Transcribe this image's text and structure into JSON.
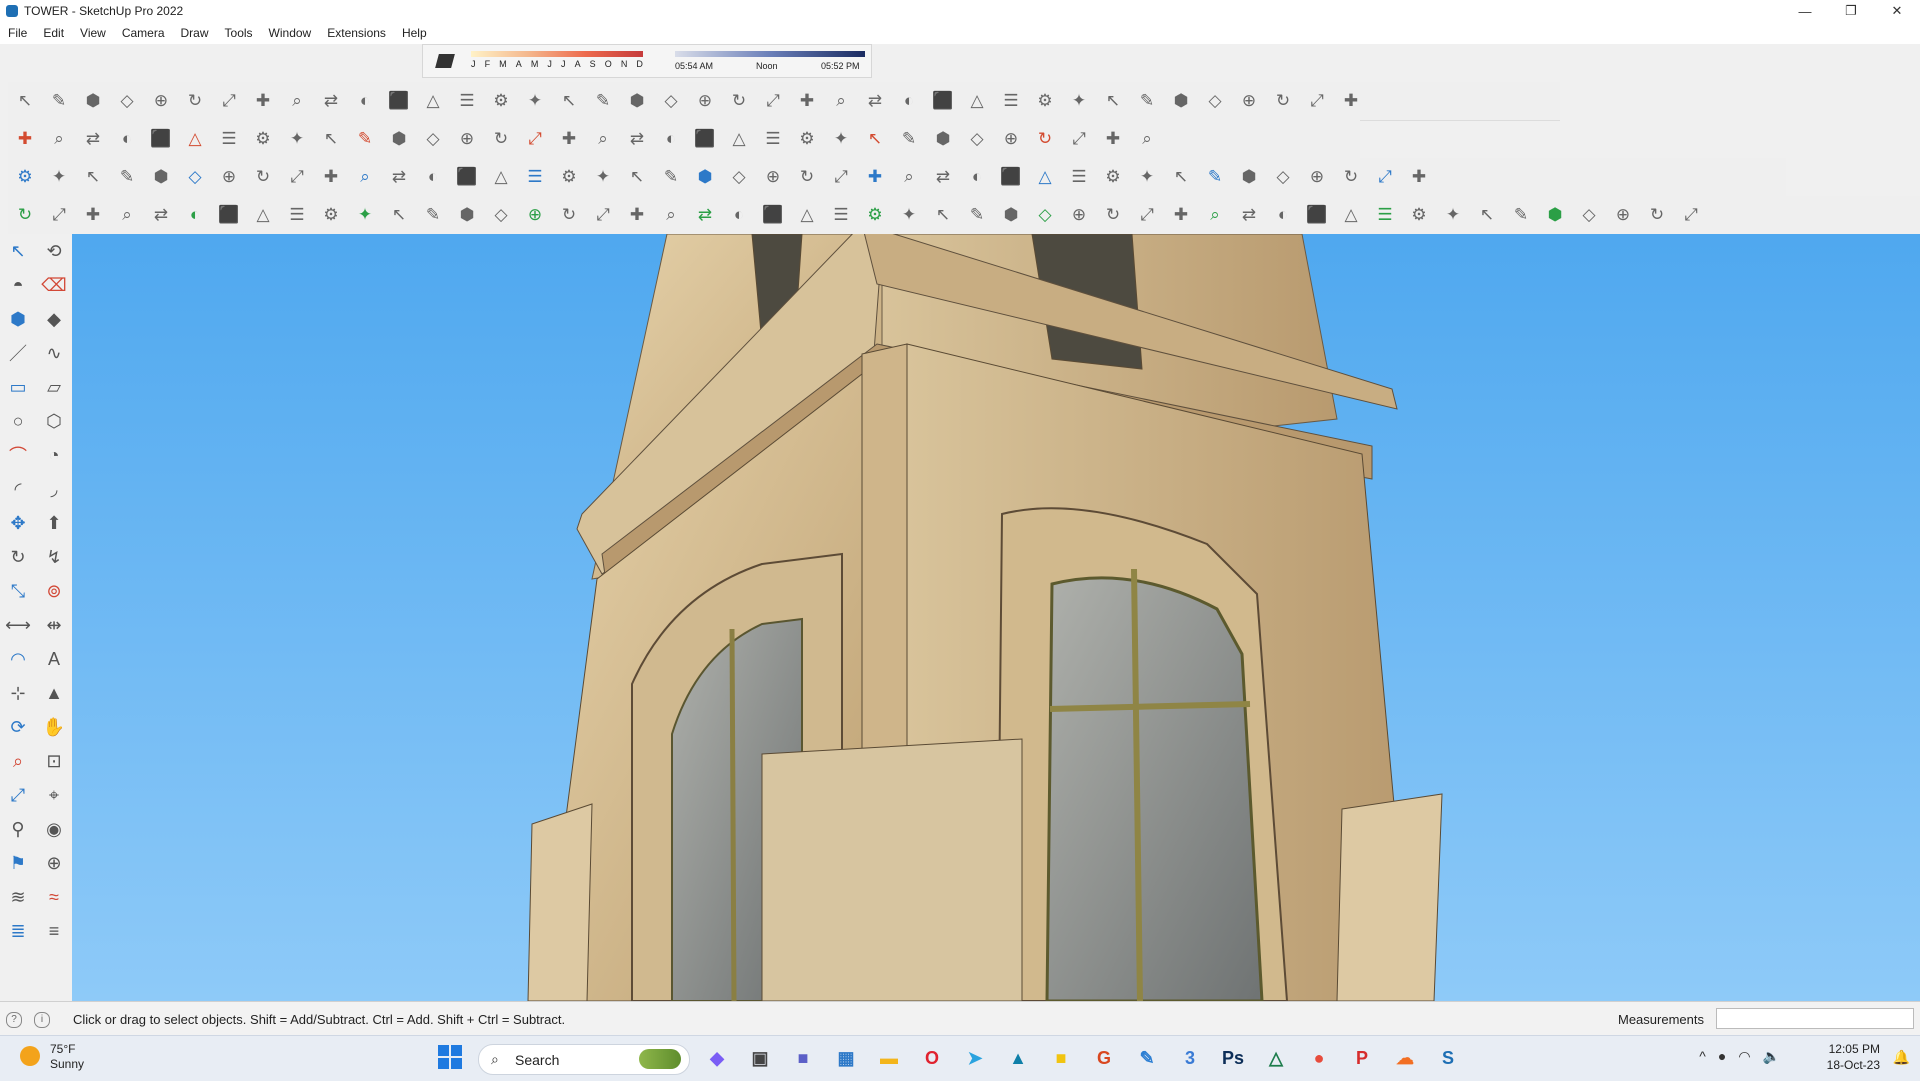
{
  "window": {
    "title": "TOWER - SketchUp Pro 2022",
    "controls": [
      "—",
      "❐",
      "✕"
    ]
  },
  "menubar": [
    "File",
    "Edit",
    "View",
    "Camera",
    "Draw",
    "Tools",
    "Window",
    "Extensions",
    "Help"
  ],
  "shadow_settings": {
    "months": [
      "J",
      "F",
      "M",
      "A",
      "M",
      "J",
      "J",
      "A",
      "S",
      "O",
      "N",
      "D"
    ],
    "time_start": "05:54 AM",
    "time_mid": "Noon",
    "time_end": "05:52 PM"
  },
  "toolbar_rows": [
    {
      "count": 40,
      "accent": "#6a6a6a"
    },
    {
      "count": 34,
      "accent": "#d34b30"
    },
    {
      "count": 42,
      "accent": "#2d79c8"
    },
    {
      "count": 50,
      "accent": "#2b9f46"
    }
  ],
  "sidebar_tools": [
    {
      "name": "select-icon",
      "glyph": "↖"
    },
    {
      "name": "orbit-icon",
      "glyph": "⟲"
    },
    {
      "name": "paint-bucket-icon",
      "glyph": "◓"
    },
    {
      "name": "eraser-icon",
      "glyph": "⌫"
    },
    {
      "name": "component-icon",
      "glyph": "⬢"
    },
    {
      "name": "tag-icon",
      "glyph": "◆"
    },
    {
      "name": "line-icon",
      "glyph": "／"
    },
    {
      "name": "freehand-icon",
      "glyph": "∿"
    },
    {
      "name": "rectangle-icon",
      "glyph": "▭"
    },
    {
      "name": "rotated-rectangle-icon",
      "glyph": "▱"
    },
    {
      "name": "circle-icon",
      "glyph": "○"
    },
    {
      "name": "polygon-icon",
      "glyph": "⬡"
    },
    {
      "name": "arc-icon",
      "glyph": "⌒"
    },
    {
      "name": "pie-icon",
      "glyph": "◔"
    },
    {
      "name": "two-point-arc-icon",
      "glyph": "◜"
    },
    {
      "name": "three-point-arc-icon",
      "glyph": "◞"
    },
    {
      "name": "move-icon",
      "glyph": "✥"
    },
    {
      "name": "push-pull-icon",
      "glyph": "⬆"
    },
    {
      "name": "rotate-icon",
      "glyph": "↻"
    },
    {
      "name": "follow-me-icon",
      "glyph": "↯"
    },
    {
      "name": "scale-icon",
      "glyph": "⤡"
    },
    {
      "name": "offset-icon",
      "glyph": "⊚"
    },
    {
      "name": "tape-measure-icon",
      "glyph": "⟷"
    },
    {
      "name": "dimension-icon",
      "glyph": "⇹"
    },
    {
      "name": "protractor-icon",
      "glyph": "◠"
    },
    {
      "name": "text-icon",
      "glyph": "A"
    },
    {
      "name": "axes-icon",
      "glyph": "⊹"
    },
    {
      "name": "section-plane-icon",
      "glyph": "▲"
    },
    {
      "name": "orbit-tool-icon",
      "glyph": "⟳"
    },
    {
      "name": "pan-icon",
      "glyph": "✋"
    },
    {
      "name": "zoom-icon",
      "glyph": "⌕"
    },
    {
      "name": "zoom-window-icon",
      "glyph": "⊡"
    },
    {
      "name": "zoom-extents-icon",
      "glyph": "⤢"
    },
    {
      "name": "previous-view-icon",
      "glyph": "⌖"
    },
    {
      "name": "walk-icon",
      "glyph": "⚲"
    },
    {
      "name": "look-around-icon",
      "glyph": "◉"
    },
    {
      "name": "position-camera-icon",
      "glyph": "⚑"
    },
    {
      "name": "crosshair-icon",
      "glyph": "⊕"
    },
    {
      "name": "sandbox-icon",
      "glyph": "≋"
    },
    {
      "name": "smoove-icon",
      "glyph": "≈"
    },
    {
      "name": "stamp-icon",
      "glyph": "≣"
    },
    {
      "name": "drape-icon",
      "glyph": "≡"
    }
  ],
  "status": {
    "hint": "Click or drag to select objects. Shift = Add/Subtract. Ctrl = Add. Shift + Ctrl = Subtract.",
    "measurements_label": "Measurements"
  },
  "taskbar": {
    "weather_temp": "75°F",
    "weather_condition": "Sunny",
    "search_label": "Search",
    "apps": [
      {
        "name": "copilot-icon",
        "glyph": "◆",
        "color": "#7a5df5"
      },
      {
        "name": "task-view-icon",
        "glyph": "▣",
        "color": "#444444"
      },
      {
        "name": "teams-icon",
        "glyph": "■",
        "color": "#5b5fc7"
      },
      {
        "name": "calculator-icon",
        "glyph": "▦",
        "color": "#2d79c8"
      },
      {
        "name": "file-explorer-icon",
        "glyph": "▬",
        "color": "#f3b51b"
      },
      {
        "name": "opera-icon",
        "glyph": "O",
        "color": "#e0222f"
      },
      {
        "name": "telegram-icon",
        "glyph": "➤",
        "color": "#2aa3df"
      },
      {
        "name": "sketchup-ext-icon",
        "glyph": "▲",
        "color": "#0f7fa8"
      },
      {
        "name": "sticky-notes-icon",
        "glyph": "■",
        "color": "#f1c40f"
      },
      {
        "name": "shield-app-icon",
        "glyph": "G",
        "color": "#d9471f"
      },
      {
        "name": "vscode-icon",
        "glyph": "✎",
        "color": "#2d7fd3"
      },
      {
        "name": "app-3-icon",
        "glyph": "3",
        "color": "#3a7bd5"
      },
      {
        "name": "photoshop-icon",
        "glyph": "Ps",
        "color": "#0c2e58"
      },
      {
        "name": "drive-icon",
        "glyph": "△",
        "color": "#1c7c4b"
      },
      {
        "name": "chrome-icon",
        "glyph": "●",
        "color": "#e74c3c"
      },
      {
        "name": "pinterest-icon",
        "glyph": "P",
        "color": "#d62c2c"
      },
      {
        "name": "soundcloud-icon",
        "glyph": "☁",
        "color": "#f26f23"
      },
      {
        "name": "sketchup-icon",
        "glyph": "S",
        "color": "#1e6fb4"
      }
    ],
    "tray_icons": [
      {
        "name": "chevron-up-icon",
        "glyph": "^"
      },
      {
        "name": "network-app-icon",
        "glyph": "●"
      },
      {
        "name": "wifi-icon",
        "glyph": "◠"
      },
      {
        "name": "volume-icon",
        "glyph": "🔈"
      }
    ],
    "time": "12:05 PM",
    "date": "18-Oct-23"
  }
}
